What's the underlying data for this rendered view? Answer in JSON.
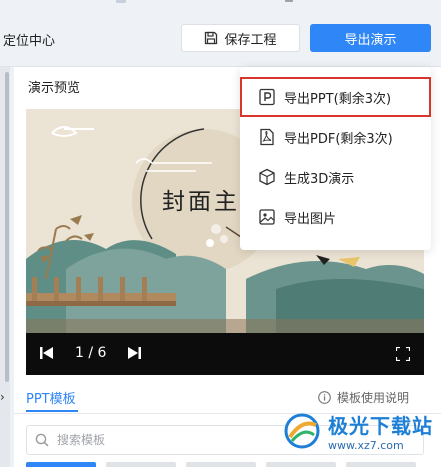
{
  "header": {
    "location_label": "定位中心",
    "save_label": "保存工程",
    "export_label": "导出演示"
  },
  "preview": {
    "title": "演示预览",
    "slide_title": "封面主",
    "page_indicator": "1 / 6"
  },
  "export_menu": {
    "items": [
      {
        "label": "导出PPT(剩余3次)",
        "icon": "ppt-file-icon",
        "highlighted": true
      },
      {
        "label": "导出PDF(剩余3次)",
        "icon": "pdf-file-icon",
        "highlighted": false
      },
      {
        "label": "生成3D演示",
        "icon": "cube-icon",
        "highlighted": false
      },
      {
        "label": "导出图片",
        "icon": "image-icon",
        "highlighted": false
      }
    ]
  },
  "templates": {
    "tab_label": "PPT模板",
    "help_label": "模板使用说明",
    "search_placeholder": "搜索模板"
  },
  "watermark": {
    "main": "极光下载站",
    "sub": "www.xz7.com"
  },
  "colors": {
    "accent": "#2f86f6",
    "highlight_border": "#d9352c",
    "video_bar": "#0c0c0c"
  }
}
